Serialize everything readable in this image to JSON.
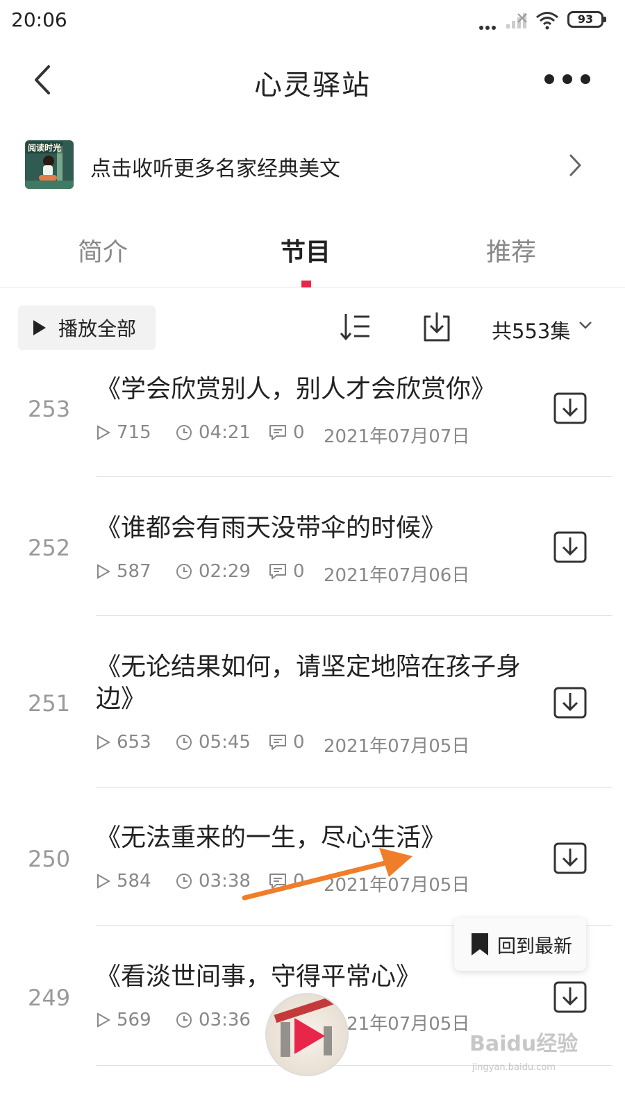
{
  "status_bar": {
    "time": "20:06",
    "battery": "93"
  },
  "header": {
    "title": "心灵驿站"
  },
  "promo": {
    "cover_text": "阅读时光",
    "text": "点击收听更多名家经典美文"
  },
  "tabs": [
    {
      "label": "简介",
      "active": false
    },
    {
      "label": "节目",
      "active": true
    },
    {
      "label": "推荐",
      "active": false
    }
  ],
  "toolbar": {
    "play_all_label": "播放全部",
    "count_label": "共553集"
  },
  "episodes": [
    {
      "num": "253",
      "title": "《学会欣赏别人，别人才会欣赏你》",
      "plays": "715",
      "duration": "04:21",
      "comments": "0",
      "date": "2021年07月07日"
    },
    {
      "num": "252",
      "title": "《谁都会有雨天没带伞的时候》",
      "plays": "587",
      "duration": "02:29",
      "comments": "0",
      "date": "2021年07月06日"
    },
    {
      "num": "251",
      "title": "《无论结果如何，请坚定地陪在孩子身边》",
      "plays": "653",
      "duration": "05:45",
      "comments": "0",
      "date": "2021年07月05日"
    },
    {
      "num": "250",
      "title": "《无法重来的一生，尽心生活》",
      "plays": "584",
      "duration": "03:38",
      "comments": "0",
      "date": "2021年07月05日"
    },
    {
      "num": "249",
      "title": "《看淡世间事，守得平常心》",
      "plays": "569",
      "duration": "03:36",
      "comments": "",
      "date": "2021年07月05日"
    }
  ],
  "floating": {
    "back_to_latest_label": "回到最新"
  },
  "watermark": {
    "text": "Baidu经验",
    "url": "jingyan.baidu.com"
  },
  "colors": {
    "accent": "#e8264a",
    "annotation_arrow": "#f07d2a"
  },
  "icons": {
    "back": "chevron-left-icon",
    "more": "more-dots-icon",
    "sort": "sort-icon",
    "download": "download-icon",
    "plays": "play-outline-icon",
    "duration": "clock-icon",
    "comments": "comment-icon",
    "bookmark": "bookmark-icon"
  }
}
